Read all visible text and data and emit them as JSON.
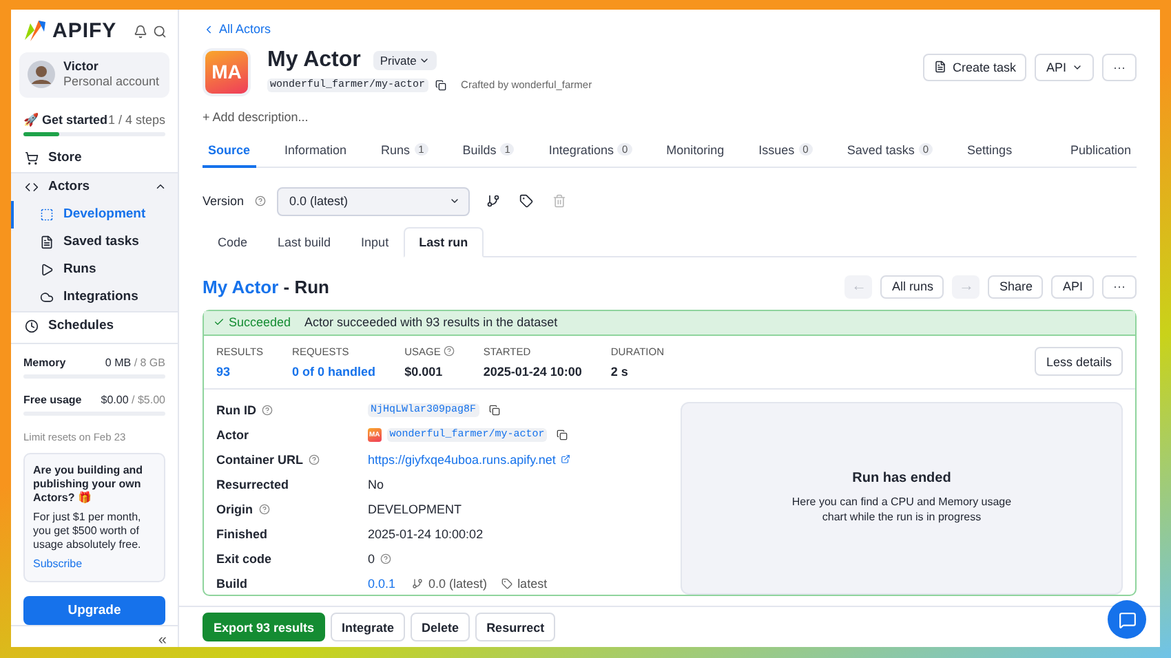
{
  "brand": {
    "name": "APIFY"
  },
  "account": {
    "name": "Victor",
    "type": "Personal account"
  },
  "get_started": {
    "label": "🚀 Get started",
    "steps": "1 / 4 steps",
    "level": 0.25
  },
  "nav": [
    {
      "label": "Store",
      "selected": false,
      "expanded": false
    },
    {
      "label": "Actors",
      "selected": false,
      "expanded": true,
      "children": [
        {
          "label": "Development",
          "selected": true
        },
        {
          "label": "Saved tasks",
          "selected": false
        },
        {
          "label": "Runs",
          "selected": false
        },
        {
          "label": "Integrations",
          "selected": false
        }
      ]
    },
    {
      "label": "Schedules",
      "selected": false,
      "expanded": false
    }
  ],
  "usage": [
    {
      "label": "Memory",
      "used": "0 MB",
      "limit": "/ 8 GB",
      "level": 0
    },
    {
      "label": "Free usage",
      "used": "$0.00",
      "limit": "/ $5.00",
      "level": 0
    }
  ],
  "limit_note": "Limit resets on Feb 23",
  "promo": {
    "title": "Are you building and publishing your own Actors? 🎁",
    "body": "For just $1 per month, you get $500 worth of usage absolutely free.",
    "link": "Subscribe"
  },
  "upgrade_button": "Upgrade",
  "collapse_button": "«",
  "breadcrumb": "All Actors",
  "actor": {
    "initials": "MA",
    "name": "My Actor",
    "visibility": "Private",
    "slug": "wonderful_farmer/my-actor",
    "crafted_by": "Crafted by wonderful_farmer",
    "add_description": "+ Add description..."
  },
  "header_buttons": [
    {
      "label": "Create task",
      "kind": "task"
    },
    {
      "label": "API",
      "kind": "dropdown"
    },
    {
      "label": "···",
      "kind": "more"
    }
  ],
  "tabs": [
    {
      "label": "Source",
      "selected": true
    },
    {
      "label": "Information",
      "selected": false
    },
    {
      "label": "Runs",
      "count": "1",
      "selected": false
    },
    {
      "label": "Builds",
      "count": "1",
      "selected": false
    },
    {
      "label": "Integrations",
      "count": "0",
      "selected": false
    },
    {
      "label": "Monitoring",
      "selected": false
    },
    {
      "label": "Issues",
      "count": "0",
      "selected": false
    },
    {
      "label": "Saved tasks",
      "count": "0",
      "selected": false
    },
    {
      "label": "Settings",
      "selected": false
    },
    {
      "label": "Publication",
      "selected": false
    }
  ],
  "version": {
    "label": "Version",
    "value": "0.0 (latest)"
  },
  "subtabs": [
    {
      "label": "Code",
      "selected": false
    },
    {
      "label": "Last build",
      "selected": false
    },
    {
      "label": "Input",
      "selected": false
    },
    {
      "label": "Last run",
      "selected": true
    }
  ],
  "run": {
    "actor_link": "My Actor",
    "title_rest": " - Run",
    "buttons": [
      {
        "label": "←",
        "kind": "arrow",
        "disabled": true
      },
      {
        "label": "All runs",
        "kind": "text",
        "disabled": false
      },
      {
        "label": "→",
        "kind": "arrow",
        "disabled": true
      },
      {
        "label": "Share",
        "kind": "text",
        "disabled": false
      },
      {
        "label": "API",
        "kind": "text",
        "disabled": false
      },
      {
        "label": "···",
        "kind": "text",
        "disabled": false
      }
    ],
    "status": "Succeeded",
    "status_message": "Actor succeeded with 93 results in the dataset",
    "stats": [
      {
        "label": "RESULTS",
        "value": "93",
        "kind": "link",
        "help": false
      },
      {
        "label": "REQUESTS",
        "value": "0 of 0 handled",
        "kind": "link",
        "help": false
      },
      {
        "label": "USAGE",
        "value": "$0.001",
        "kind": "text",
        "help": true
      },
      {
        "label": "STARTED",
        "value": "2025-01-24 10:00",
        "kind": "text",
        "help": false
      },
      {
        "label": "DURATION",
        "value": "2 s",
        "kind": "text",
        "help": false
      }
    ],
    "less_details": "Less details",
    "details": [
      {
        "label": "Run ID",
        "help": true,
        "kind": "code",
        "value": "NjHqLWlar309pag8F",
        "copy": true
      },
      {
        "label": "Actor",
        "help": false,
        "kind": "actor",
        "value": "wonderful_farmer/my-actor",
        "badge": "MA",
        "copy": true
      },
      {
        "label": "Container URL",
        "help": true,
        "kind": "url",
        "value": "https://giyfxqe4uboa.runs.apify.net",
        "copy": false
      },
      {
        "label": "Resurrected",
        "help": false,
        "kind": "text",
        "value": "No",
        "copy": false
      },
      {
        "label": "Origin",
        "help": true,
        "kind": "text",
        "value": "DEVELOPMENT",
        "copy": false
      },
      {
        "label": "Finished",
        "help": false,
        "kind": "text",
        "value": "2025-01-24 10:00:02",
        "copy": false
      },
      {
        "label": "Exit code",
        "help": false,
        "kind": "exit",
        "value": "0",
        "copy": false
      },
      {
        "label": "Build",
        "help": false,
        "kind": "build",
        "value": "0.0.1",
        "branch": "0.0 (latest)",
        "tag": "latest",
        "copy": false
      }
    ],
    "chart_panel": {
      "title": "Run has ended",
      "text": "Here you can find a CPU and Memory usage chart while the run is in progress"
    }
  },
  "actions": [
    {
      "label": "Export 93 results",
      "kind": "primary"
    },
    {
      "label": "Integrate",
      "kind": "secondary"
    },
    {
      "label": "Delete",
      "kind": "secondary"
    },
    {
      "label": "Resurrect",
      "kind": "secondary"
    }
  ]
}
